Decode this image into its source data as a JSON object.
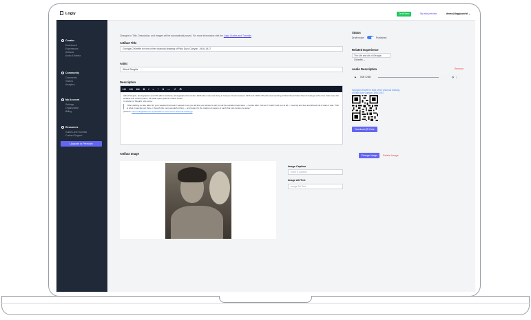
{
  "app": {
    "logo": "Logiy"
  },
  "topbar": {
    "status_badge": "Draft Item",
    "link": "My site preview",
    "user": "demo@logiy.world"
  },
  "sidebar": {
    "sections": [
      {
        "title": "Curator",
        "items": [
          "Dashboard",
          "Experiences",
          "Artifacts",
          "Audio & Media"
        ]
      },
      {
        "title": "Community",
        "items": [
          "Comments",
          "Visitors",
          "Analytics"
        ]
      },
      {
        "title": "My Account",
        "items": [
          "Settings",
          "Organization",
          "Billing"
        ]
      },
      {
        "title": "Resources",
        "items": [
          "Guides and Tutorials",
          "Contact Support"
        ]
      }
    ],
    "upgrade": "Upgrade to Premium"
  },
  "notice": {
    "text": "Changes to Title, Description, and Images will be automatically saved. For more information visit the",
    "link": "Logiy Guides and Tutorials"
  },
  "form": {
    "title_label": "Artifact Title",
    "title_value": "Georgia O'Keeffe in front of her charcoal drawing of Palo Duro Canyon, 1916-1917",
    "artist_label": "Artist",
    "artist_value": "Alfred Stieglitz",
    "description_label": "Description",
    "toolbar": [
      "H2",
      "H3",
      "H4",
      "B",
      "I",
      "≡",
      "“",
      "U",
      "—",
      "↗",
      "⟲"
    ],
    "description": {
      "p1": "Alfred Stieglitz, photographer and O'Keeffe's husband, photographed her before 1916 when she was living in Canyon, Texas between 1916 and 1918, O'Keeffe was teaching at West Texas State Normal College at the time. She loved the endless and colorful plains, the wide-open spaces of West Texas.",
      "p2": "In a letter to Stieglitz, she wrote:",
      "quote": "\"After walking so late (after for your weekend) at least I wanted to tell you all that you wanted to tell you all the outsiders said were — before after I felt as if I hadn't told you at all — how big and free and almost full of stars it was. That is what it was like out there. I thought the most wonderful thing — and today it's the making of papers of each that just carries me away.\"",
      "source_label": "(Source:",
      "source_link": "https://stieglitzlenses.org/okeeffe-in-front-of-her-charcoal-drawing/)"
    },
    "image_label": "Artifact Image",
    "change_image": "Change Image",
    "delete_image": "Delete Image",
    "caption_label": "Image Caption",
    "caption_placeholder": "Enter a caption",
    "alt_label": "Image Alt Text",
    "alt_placeholder": "Image Alt Text"
  },
  "right": {
    "status_label": "Status",
    "draft_mode": "Draft mode",
    "published": "Published",
    "related_label": "Related Experience",
    "related_value": "The Life and Art of Georgia O'Keeffe",
    "audio_label": "Audio Description",
    "remove": "Remove",
    "audio_time": "0:00 / 2:58",
    "qr_link": "Georgia O'Keeffe in front of her charcoal drawing of Palo Duro Canyon, 1916-1917",
    "download_qr": "Download QR Code"
  }
}
